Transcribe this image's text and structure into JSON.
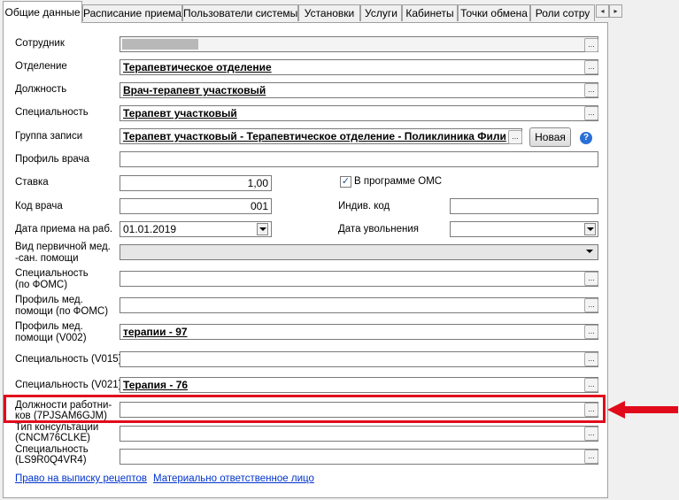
{
  "tabs": [
    {
      "label": "Общие данные"
    },
    {
      "label": "Расписание приема"
    },
    {
      "label": "Пользователи системы"
    },
    {
      "label": "Установки"
    },
    {
      "label": "Услуги"
    },
    {
      "label": "Кабинеты"
    },
    {
      "label": "Точки обмена"
    },
    {
      "label": "Роли сотру"
    }
  ],
  "tab_scroll": {
    "left": "◂",
    "right": "▸"
  },
  "form": {
    "employee": {
      "label": "Сотрудник",
      "value": ""
    },
    "department": {
      "label": "Отделение",
      "value": "Терапевтическое отделение"
    },
    "position": {
      "label": "Должность",
      "value": "Врач-терапевт участковый"
    },
    "specialty": {
      "label": "Специальность",
      "value": "Терапевт участковый"
    },
    "record_group": {
      "label": "Группа записи",
      "value": "Терапевт участковый - Терапевтическое отделение - Поликлиника Фили",
      "new_button": "Новая"
    },
    "doctor_profile": {
      "label": "Профиль врача",
      "value": ""
    },
    "rate": {
      "label": "Ставка",
      "value": "1,00"
    },
    "oms": {
      "label": "В программе ОМС",
      "checked": true
    },
    "doctor_code": {
      "label": "Код врача",
      "value": "001"
    },
    "individual_code": {
      "label": "Индив. код",
      "value": ""
    },
    "hire_date": {
      "label": "Дата приема на раб.",
      "value": "01.01.2019"
    },
    "dismissal_date": {
      "label": "Дата увольнения",
      "value": ""
    },
    "primary_care_type": {
      "label_1": "Вид первичной мед.",
      "label_2": "-сан. помощи",
      "value": ""
    },
    "specialty_foms": {
      "label_1": "Специальность",
      "label_2": "(по ФОМС)",
      "value": ""
    },
    "care_profile_foms": {
      "label_1": "Профиль  мед.",
      "label_2": "помощи (по ФОМС)",
      "value": ""
    },
    "care_profile_v002": {
      "label_1": "Профиль  мед.",
      "label_2": "помощи (V002)",
      "value": "терапии - 97"
    },
    "specialty_v015": {
      "label": "Специальность (V015)",
      "value": ""
    },
    "specialty_v021": {
      "label": "Специальность (V021)",
      "value": "Терапия - 76"
    },
    "worker_positions": {
      "label_1": "Должности работни-",
      "label_2": "ков (7PJSAM6GJM)",
      "value": ""
    },
    "consultation_type": {
      "label_1": "Тип консультации",
      "label_2": "(CNCM76CLKE)",
      "value": ""
    },
    "specialty_extra": {
      "label_1": "Специальность",
      "label_2": "(LS9R0Q4VR4)",
      "value": ""
    }
  },
  "links": {
    "prescription_right": "Право на выписку рецептов",
    "responsible_person": "Материально ответственное лицо"
  },
  "icons": {
    "ellipsis": "...",
    "help": "?",
    "check": "✓"
  },
  "colors": {
    "highlight": "#e10a1b",
    "link": "#0033cc"
  }
}
